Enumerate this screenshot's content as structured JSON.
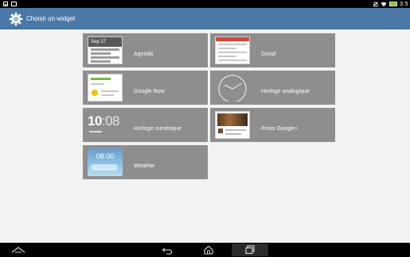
{
  "action_bar": {
    "title": "Choisir un widget",
    "icon": "gear-icon"
  },
  "status_bar": {
    "time": "3:5",
    "left_icons": [
      "image-icon",
      "screenshot-icon"
    ],
    "right_icons": [
      "no-sim-icon",
      "wifi-icon",
      "battery-icon"
    ]
  },
  "widgets": [
    {
      "label": "Agenda",
      "icon": "agenda-preview",
      "preview": {
        "date": "Sep 27"
      }
    },
    {
      "label": "Gmail",
      "icon": "gmail-preview"
    },
    {
      "label": "Google Now",
      "icon": "google-now-preview"
    },
    {
      "label": "Horloge analogique",
      "icon": "analog-clock-preview"
    },
    {
      "label": "Horloge numérique",
      "icon": "digital-clock-preview",
      "preview": {
        "hour": "10",
        "minutes": ":08"
      }
    },
    {
      "label": "Posts Google+",
      "icon": "google-plus-posts-preview"
    },
    {
      "label": "Weather",
      "icon": "weather-preview",
      "preview": {
        "time": "08:00"
      }
    }
  ],
  "nav_bar": {
    "items": [
      "hide-keyboard-icon",
      "back-icon",
      "home-icon",
      "recents-icon"
    ]
  },
  "colors": {
    "action_bar": "#4a79a8",
    "tile": "#8e8e8e",
    "background": "#f2f2f2"
  }
}
